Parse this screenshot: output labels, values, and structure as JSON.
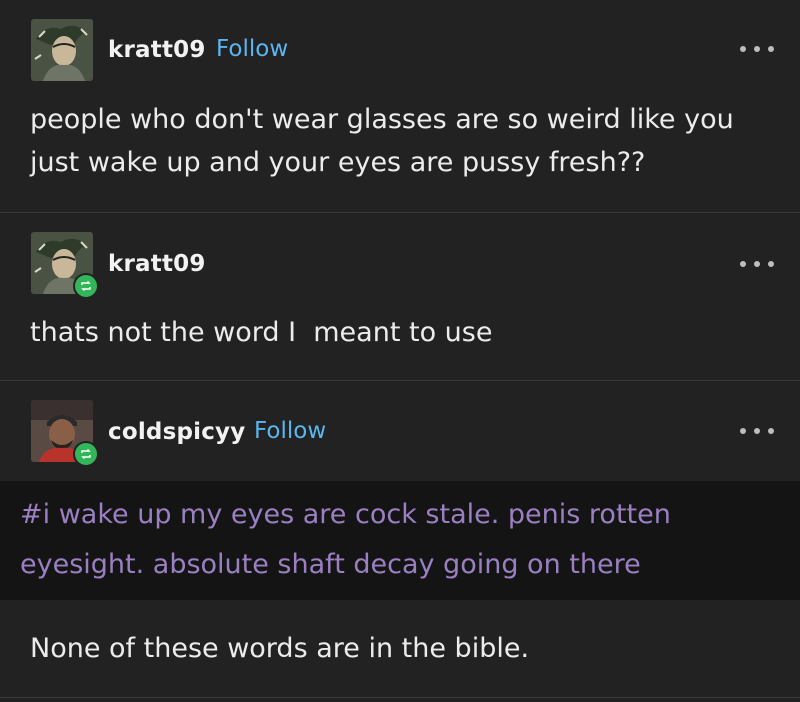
{
  "posts": [
    {
      "username": "kratt09",
      "follow_label": "Follow",
      "text_lines": [
        "people who don't wear glasses are so weird like you",
        "just wake up and your eyes are pussy fresh??"
      ]
    },
    {
      "username": "kratt09",
      "text_lines": [
        "thats not the word I  meant to use"
      ]
    },
    {
      "username": "coldspicyy",
      "follow_label": "Follow",
      "tag_lines": [
        "#i wake up my eyes are cock stale. penis rotten",
        "eyesight. absolute shaft decay going on there"
      ],
      "text_lines": [
        "None of these words are in the bible."
      ]
    }
  ],
  "icons": {
    "more": "ellipsis-icon",
    "reblog": "reblog-icon"
  },
  "colors": {
    "background": "#222222",
    "follow": "#5bb5ee",
    "tag": "#9a80c2",
    "reblog_badge": "#33b55a",
    "tag_band": "#141414"
  }
}
